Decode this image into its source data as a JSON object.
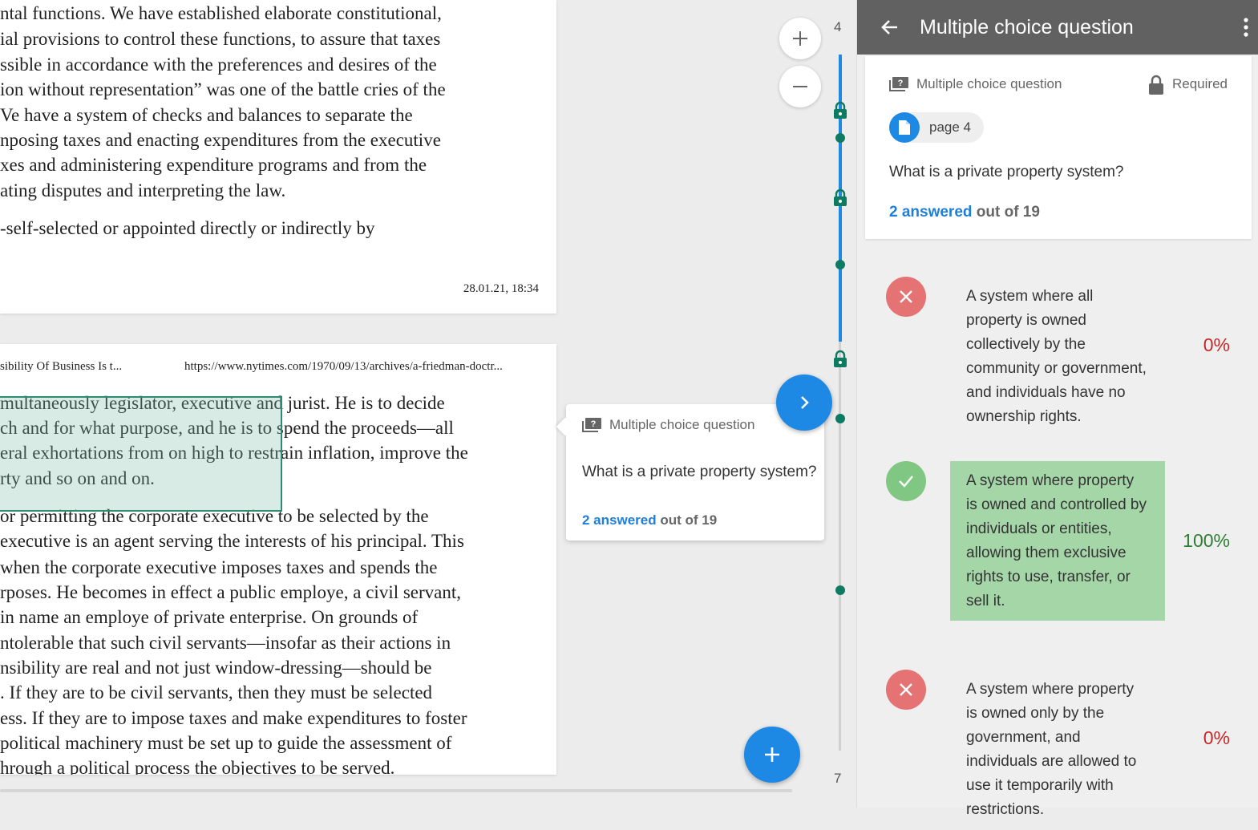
{
  "document": {
    "page1": {
      "lines": [
        "ntal functions. We have established elaborate constitutional,",
        "ial provisions to control these functions, to assure that taxes",
        "ssible in accordance with the preferences and desires of the",
        "ion without representation” was one of the battle cries of the",
        "Ve have a system of checks and balances to separate the",
        "nposing taxes and enacting expenditures from the executive",
        "xes and administering expenditure programs and from the",
        "ating disputes and interpreting the law.",
        "-self-selected or appointed directly or indirectly by"
      ],
      "date": "28.01.21, 18:34"
    },
    "page2": {
      "header_title": "sibility Of Business Is t...",
      "header_url": "https://www.nytimes.com/1970/09/13/archives/a-friedman-doctr...",
      "lines": [
        "multaneously legislator, executive and jurist. He is to decide",
        "ch and for what purpose, and he is to spend the proceeds—all",
        "eral exhortations from on high to restrain inflation, improve the",
        "rty and so on and on.",
        "or permitting the corporate executive to be selected by the",
        "executive is an agent serving the interests of his principal. This",
        "when the corporate executive imposes taxes and spends the",
        "rposes. He becomes in effect a public employe, a civil servant,",
        " in name an employe of private enterprise. On grounds of",
        "ntolerable that such civil servants—insofar as their actions in",
        "nsibility are real and not just window-dressing—should be",
        ". If they are to be civil servants, then they must be selected",
        "ess. If they are to impose taxes and make expenditures to foster",
        " political machinery must be set up to guide the assessment of",
        "hrough a political process the objectives to be served."
      ]
    }
  },
  "timeline": {
    "top_label": "4",
    "bottom_label": "7",
    "accent": "#1e88e5",
    "dot_color": "#0d7a62"
  },
  "popup": {
    "type_label": "Multiple choice question",
    "question": "What is a private property system?",
    "answered": "2 answered",
    "out_of": "out of 19"
  },
  "panel": {
    "title": "Multiple choice question",
    "type_label": "Multiple choice question",
    "required_label": "Required",
    "page_label": "page 4",
    "question": "What is a private property system?",
    "answered": "2 answered",
    "out_of": "out of 19",
    "options": [
      {
        "text": "A system where all property is owned collectively by the community or government, and individuals have no ownership rights.",
        "percent": "0%",
        "correct": false
      },
      {
        "text": "A system where property is owned and controlled by individuals or entities, allowing them exclusive rights to use, transfer, or sell it.",
        "percent": "100%",
        "correct": true
      },
      {
        "text": "A system where property is owned only by the government, and individuals are allowed to use it temporarily with restrictions.",
        "percent": "0%",
        "correct": false
      }
    ]
  },
  "colors": {
    "header_bg": "#616161",
    "correct_bg": "#a5d6a7",
    "correct_text": "#2e7d32",
    "wrong_text": "#c62828",
    "wrong_circle": "#e57373"
  }
}
